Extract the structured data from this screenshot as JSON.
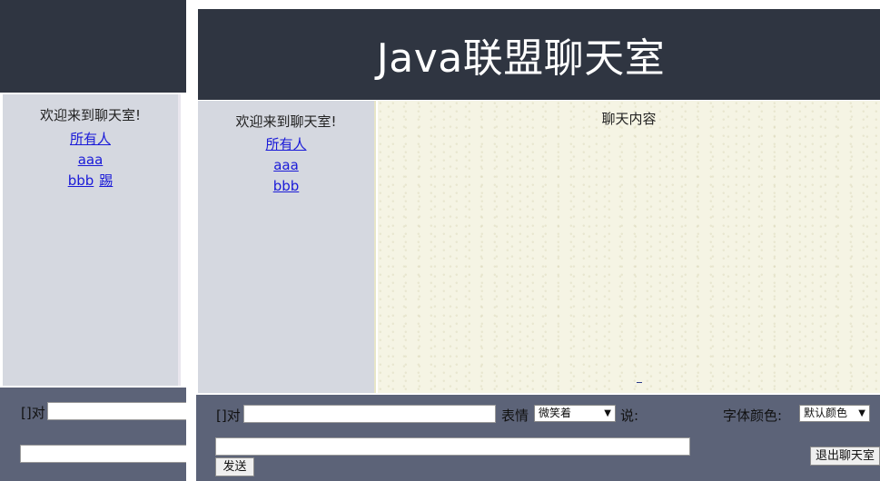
{
  "chat": {
    "title": "Java联盟聊天室",
    "welcome": "欢迎来到聊天室!",
    "content_title": "聊天内容"
  },
  "windowA": {
    "users": [
      {
        "name": "所有人"
      },
      {
        "name": "aaa"
      },
      {
        "name": "bbb",
        "kick": "踢"
      }
    ],
    "to_label": "[]对"
  },
  "windowB": {
    "users": [
      {
        "name": "所有人"
      },
      {
        "name": "aaa"
      },
      {
        "name": "bbb"
      }
    ],
    "to_label": "[]对",
    "expression_label": "表情",
    "expression_selected": "微笑着",
    "say_label": "说:",
    "font_color_label": "字体颜色:",
    "font_color_selected": "默认颜色",
    "send_button": "发送",
    "exit_button": "退出聊天室"
  },
  "colors": {
    "header_bg": "#2f3541",
    "sidebar_bg": "#d5d8e0",
    "content_bg": "#f5f4e4",
    "bottom_bg": "#5c6378",
    "link": "#1a1ad8"
  }
}
